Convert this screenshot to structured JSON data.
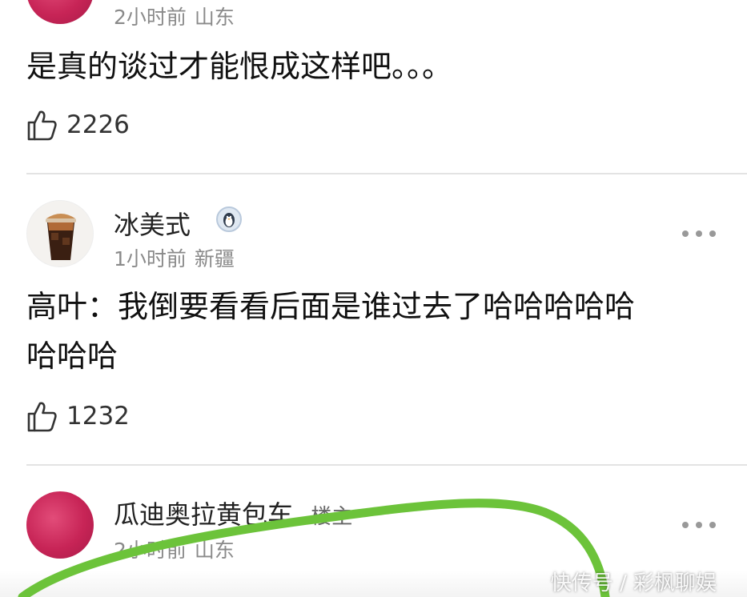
{
  "comments": [
    {
      "meta_time": "2小时前",
      "meta_location": "山东",
      "text": "是真的谈过才能恨成这样吧。。。",
      "likes": "2226"
    },
    {
      "username": "冰美式",
      "meta_time": "1小时前",
      "meta_location": "新疆",
      "text_line1": "高叶：我倒要看看后面是谁过去了哈哈哈哈哈",
      "text_line2": "哈哈哈",
      "likes": "1232"
    },
    {
      "username": "瓜迪奥拉黄包车",
      "author_tag": "楼主",
      "meta_time": "2小时前",
      "meta_location": "山东"
    }
  ],
  "watermark": "快传号 / 彩枫聊娱",
  "icons": {
    "like": "thumbs-up-icon",
    "more": "more-dots-icon",
    "badge": "penguin-badge-icon"
  },
  "colors": {
    "annotation_stroke": "#6cc33a",
    "pink_avatar": "#c72456",
    "meta_text": "#8a8a8a"
  }
}
